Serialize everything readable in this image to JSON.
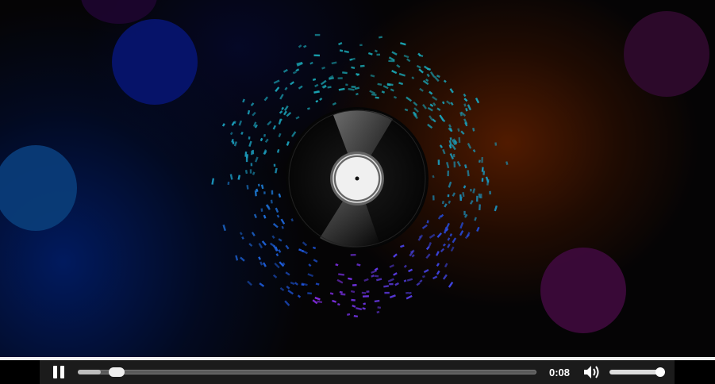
{
  "player": {
    "time_elapsed": "0:08",
    "progress_fraction": 0.05,
    "volume_fraction": 1.0,
    "state": "playing"
  },
  "colors": {
    "control_bar": "#1b1b1b",
    "visualizer_teal": "#1aa9b5",
    "visualizer_blue": "#1e4fe0",
    "visualizer_purple": "#8a2ce8",
    "orb_blue": "#06146e",
    "orb_cyan": "#0a3c78",
    "orb_magenta": "#3c0a3a"
  },
  "icons": {
    "play_state": "pause-icon",
    "volume": "speaker-icon"
  }
}
